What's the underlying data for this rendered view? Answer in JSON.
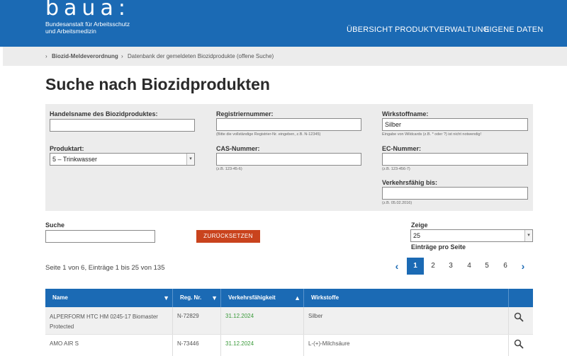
{
  "header": {
    "logo_word": "baua:",
    "logo_line1": "Bundesanstalt für Arbeitsschutz",
    "logo_line2": "und Arbeitsmedizin",
    "nav": [
      "ÜBERSICHT",
      "PRODUKTVERWALTUNG",
      "EIGENE DATEN"
    ]
  },
  "breadcrumb": {
    "item1": "Biozid-Meldeverordnung",
    "item2": "Datenbank der gemeldeten Biozidprodukte (offene Suche)"
  },
  "page_title": "Suche nach Biozidprodukten",
  "form": {
    "handelsname_label": "Handelsname des Biozidproduktes:",
    "handelsname_value": "",
    "registriernummer_label": "Registriernummer:",
    "registriernummer_value": "",
    "registriernummer_hint": "(Bitte die vollständige Registrier-Nr. eingeben, z.B. N-12345)",
    "wirkstoff_label": "Wirkstoffname:",
    "wirkstoff_value": "Silber",
    "wirkstoff_hint": "Eingabe von Wildcards (z.B. * oder ?) ist nicht notwendig!",
    "produktart_label": "Produktart:",
    "produktart_value": "5 – Trinkwasser",
    "cas_label": "CAS-Nummer:",
    "cas_value": "",
    "cas_hint": "(z.B. 123-45-6)",
    "ec_label": "EC-Nummer:",
    "ec_value": "",
    "ec_hint": "(z.B. 123-456-7)",
    "verkehr_label": "Verkehrsfähig bis:",
    "verkehr_value": "",
    "verkehr_hint": "(z.B. 05.02.2016)"
  },
  "suche": {
    "label": "Suche",
    "value": ""
  },
  "reset_label": "ZURÜCKSETZEN",
  "zeige": {
    "label": "Zeige",
    "value": "25",
    "sub": "Einträge pro Seite"
  },
  "pager": {
    "info": "Seite 1 von 6, Einträge 1 bis 25 von 135",
    "prev": "‹",
    "next": "›",
    "pages": [
      "1",
      "2",
      "3",
      "4",
      "5",
      "6"
    ]
  },
  "table": {
    "headers": [
      "Name",
      "Reg. Nr.",
      "Verkehrsfähigkeit",
      "Wirkstoffe"
    ],
    "rows": [
      {
        "name_line1": "ALPERFORM HTC HM 0245-17 Biomaster",
        "name_line2": "Protected",
        "reg": "N-72829",
        "date": "31.12.2024",
        "wirkstoff": "Silber"
      },
      {
        "name_line1": "AMO AIR S",
        "name_line2": "",
        "reg": "N-73446",
        "date": "31.12.2024",
        "wirkstoff": "L-(+)-Milchsäure"
      }
    ]
  },
  "colors": {
    "brand_blue": "#1b6ab4",
    "reset_orange": "#c9431d",
    "date_green": "#3a9a3a"
  }
}
